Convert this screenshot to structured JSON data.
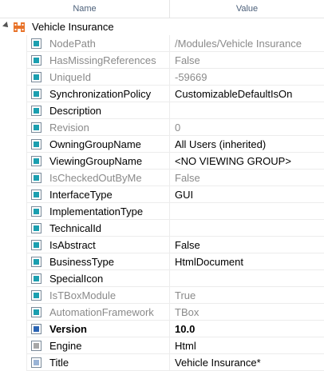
{
  "header": {
    "name_col": "Name",
    "value_col": "Value"
  },
  "root": {
    "label": "Vehicle Insurance",
    "icon": "module-icon"
  },
  "rows": [
    {
      "name": "NodePath",
      "value": "/Modules/Vehicle Insurance",
      "readonly": true
    },
    {
      "name": "HasMissingReferences",
      "value": "False",
      "readonly": true
    },
    {
      "name": "UniqueId",
      "value": "-59669",
      "readonly": true
    },
    {
      "name": "SynchronizationPolicy",
      "value": "CustomizableDefaultIsOn",
      "readonly": false
    },
    {
      "name": "Description",
      "value": "",
      "readonly": false
    },
    {
      "name": "Revision",
      "value": "0",
      "readonly": true
    },
    {
      "name": "OwningGroupName",
      "value": "All Users (inherited)",
      "readonly": false
    },
    {
      "name": "ViewingGroupName",
      "value": "<NO VIEWING GROUP>",
      "readonly": false
    },
    {
      "name": "IsCheckedOutByMe",
      "value": "False",
      "readonly": true
    },
    {
      "name": "InterfaceType",
      "value": "GUI",
      "readonly": false
    },
    {
      "name": "ImplementationType",
      "value": "",
      "readonly": false
    },
    {
      "name": "TechnicalId",
      "value": "",
      "readonly": false
    },
    {
      "name": "IsAbstract",
      "value": "False",
      "readonly": false
    },
    {
      "name": "BusinessType",
      "value": "HtmlDocument",
      "readonly": false
    },
    {
      "name": "SpecialIcon",
      "value": "",
      "readonly": false
    },
    {
      "name": "IsTBoxModule",
      "value": "True",
      "readonly": true
    },
    {
      "name": "AutomationFramework",
      "value": "TBox",
      "readonly": true
    },
    {
      "name": "Version",
      "value": "10.0",
      "readonly": false,
      "bold": true
    },
    {
      "name": "Engine",
      "value": "Html",
      "readonly": false
    },
    {
      "name": "Title",
      "value": "Vehicle Insurance*",
      "readonly": false
    }
  ],
  "colors": {
    "teal": "#1b9fb0",
    "blue": "#2a64b4",
    "gray": "#a7a7a7",
    "light_blue": "#9ab4d6",
    "orange": "#e8732a"
  }
}
